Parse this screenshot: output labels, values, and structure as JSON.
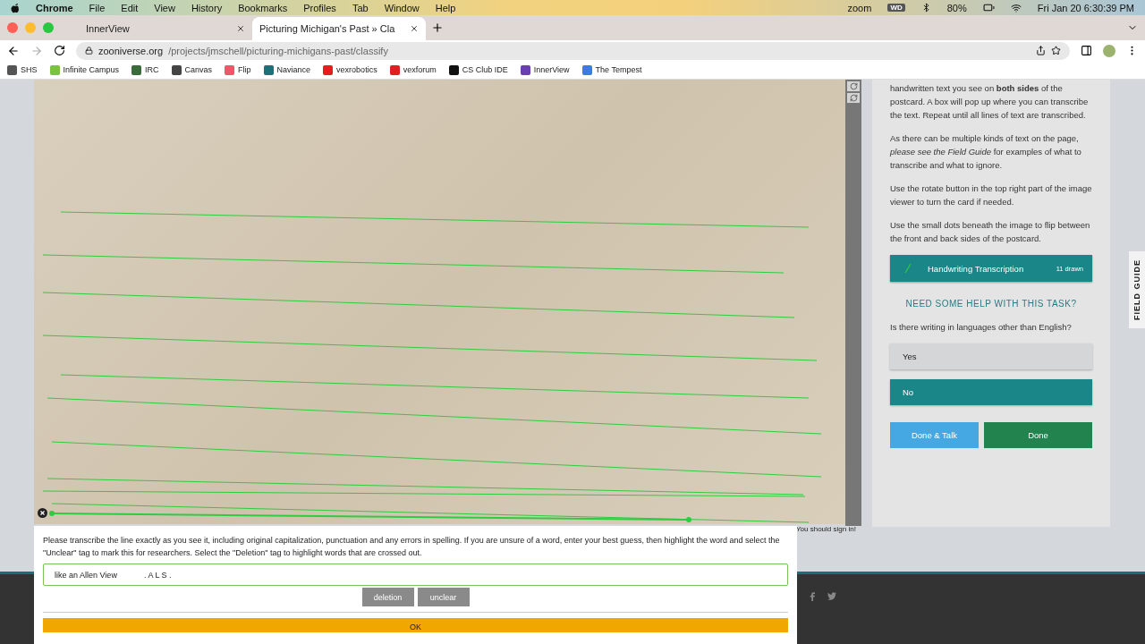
{
  "menubar": {
    "app": "Chrome",
    "menus": [
      "File",
      "Edit",
      "View",
      "History",
      "Bookmarks",
      "Profiles",
      "Tab",
      "Window",
      "Help"
    ],
    "status": {
      "zoom": "zoom",
      "drive": "WD",
      "battery": "80%",
      "datetime": "Fri Jan 20  6:30:39 PM"
    }
  },
  "tabs": [
    {
      "title": "InnerView",
      "selected": false
    },
    {
      "title": "Picturing Michigan's Past » Cla",
      "selected": true
    }
  ],
  "address": {
    "host": "zooniverse.org",
    "path": "/projects/jmschell/picturing-michigans-past/classify"
  },
  "bookmarks": [
    {
      "label": "SHS",
      "color": "#555555"
    },
    {
      "label": "Infinite Campus",
      "color": "#7cc242"
    },
    {
      "label": "IRC",
      "color": "#3a6b3a"
    },
    {
      "label": "Canvas",
      "color": "#444444"
    },
    {
      "label": "Flip",
      "color": "#f0566a"
    },
    {
      "label": "Naviance",
      "color": "#1f6f78"
    },
    {
      "label": "vexrobotics",
      "color": "#e02020"
    },
    {
      "label": "vexforum",
      "color": "#e02020"
    },
    {
      "label": "CS Club IDE",
      "color": "#111111"
    },
    {
      "label": "InnerView",
      "color": "#6a3fb0"
    },
    {
      "label": "The Tempest",
      "color": "#3d7be0"
    }
  ],
  "task": {
    "paragraphs": [
      "handwritten text you see on **both sides** of the postcard. A box will pop up where you can transcribe the text. Repeat until all lines of text are transcribed.",
      "As there can be multiple kinds of text on the page, *please see the Field Guide* for examples of what to transcribe and what to ignore.",
      "Use the rotate button in the top right part of the image viewer to turn the card if needed.",
      "Use the small dots beneath the image to flip between the front and back sides of the postcard."
    ],
    "tool": {
      "label": "Handwriting Transcription",
      "count": "11 drawn",
      "color": "#2ecc40",
      "selected": true
    },
    "help": "NEED SOME HELP WITH THIS TASK?",
    "question": "Is there writing in languages other than English?",
    "answers": [
      {
        "label": "Yes",
        "selected": false
      },
      {
        "label": "No",
        "selected": true
      }
    ],
    "buttons": [
      {
        "label": "Done & Talk",
        "kind": "talk"
      },
      {
        "label": "Done",
        "kind": "done"
      }
    ]
  },
  "field_guide": "FIELD GUIDE",
  "sign_in": "You should sign in!",
  "popup": {
    "instructions": "Please transcribe the line exactly as you see it, including original capitalization, punctuation and any errors in spelling. If you are unsure of a word, enter your best guess, then highlight the word and select the \"Unclear\" tag to mark this for researchers. Select the \"Deletion\" tag to highlight words that are crossed out.",
    "value": "like an Allen View            . A L S .",
    "tags": [
      "deletion",
      "unclear"
    ],
    "ok": "OK"
  }
}
